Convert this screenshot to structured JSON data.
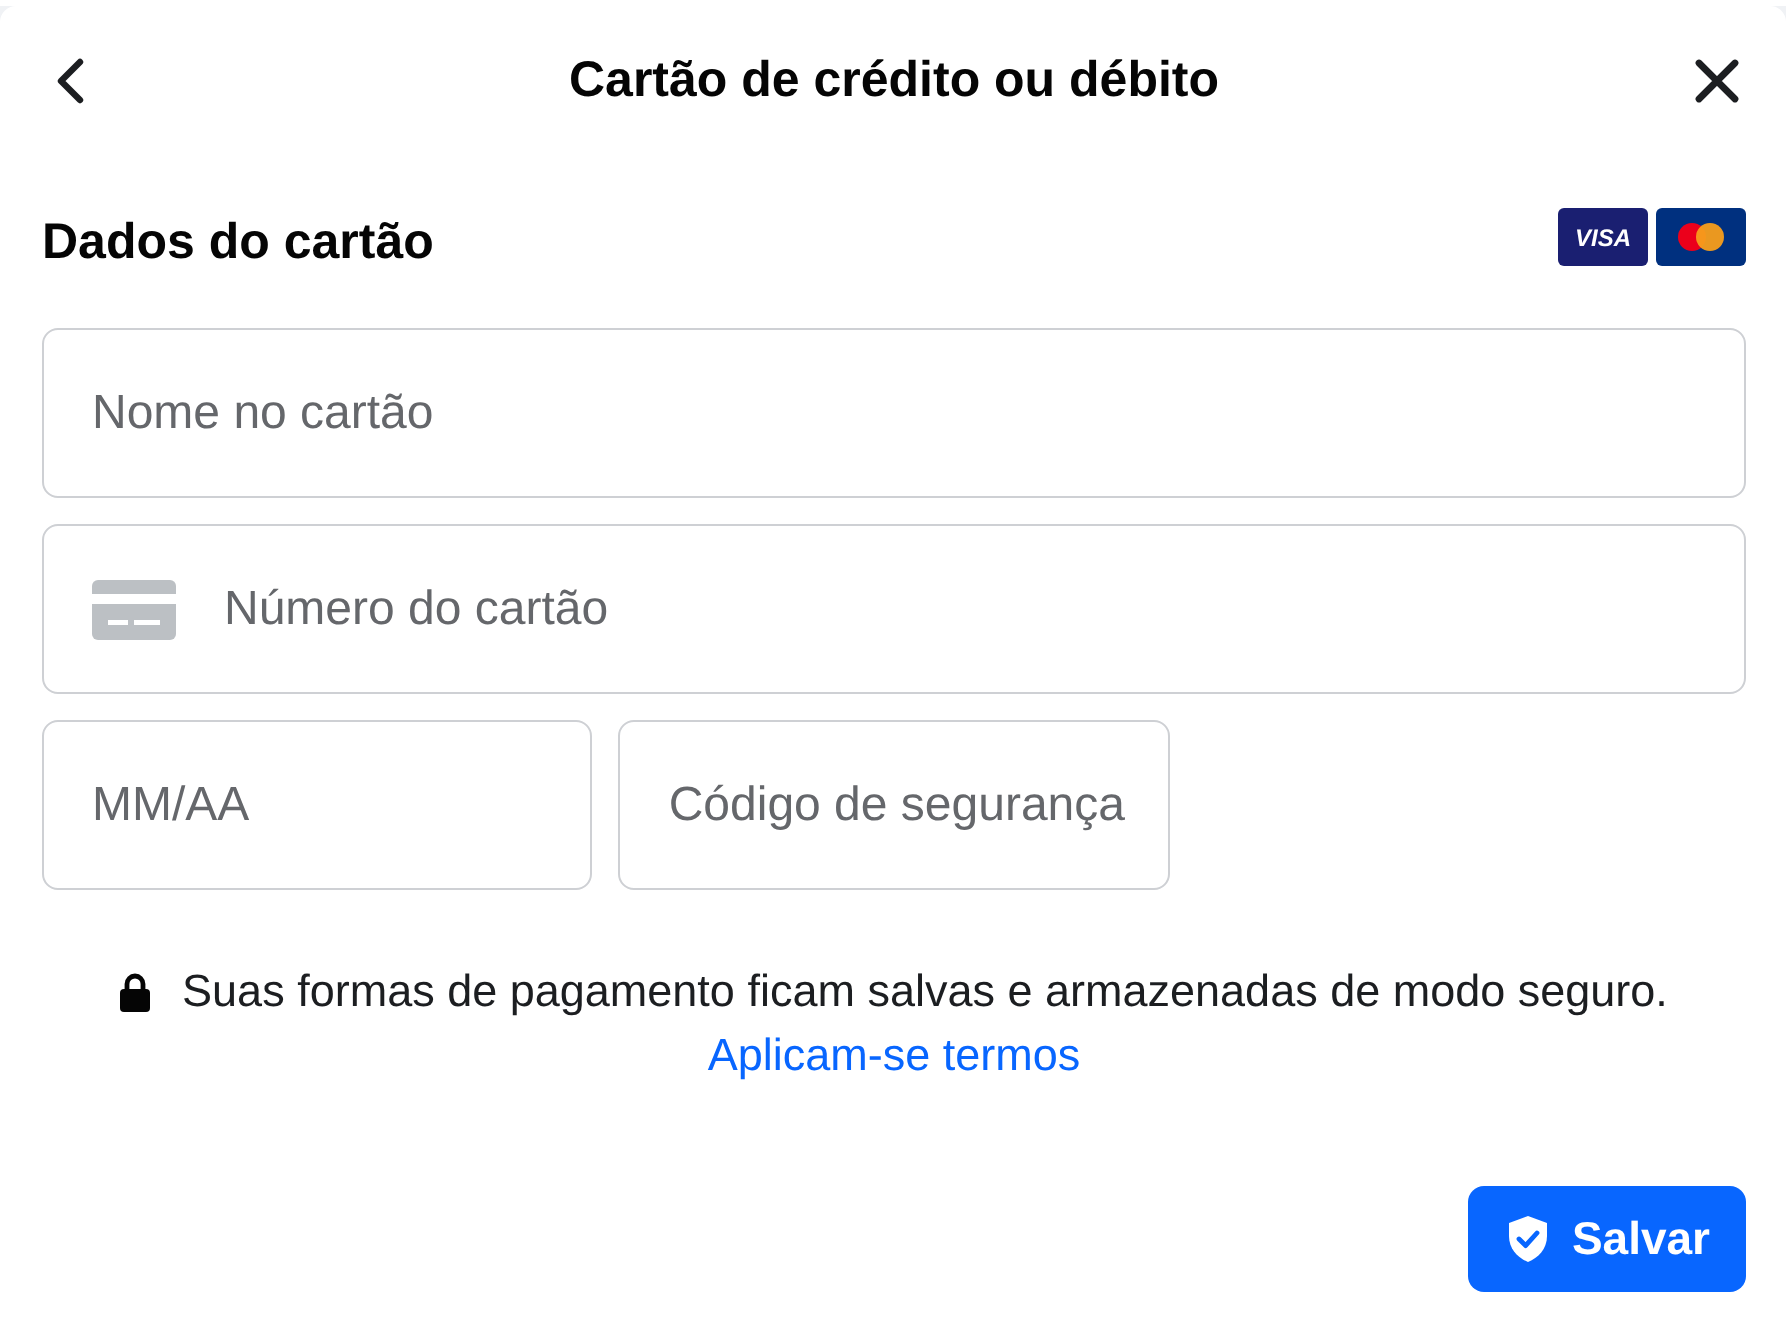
{
  "header": {
    "title": "Cartão de crédito ou débito"
  },
  "section": {
    "title": "Dados do cartão",
    "card_brands": [
      {
        "kind": "visa",
        "label": "VISA"
      },
      {
        "kind": "mastercard"
      }
    ]
  },
  "form_rows": [
    {
      "fields": [
        {
          "kind": "name",
          "placeholder": "Nome no cartão"
        }
      ]
    },
    {
      "fields": [
        {
          "kind": "card_number",
          "placeholder": "Número do cartão"
        }
      ]
    },
    {
      "fields": [
        {
          "kind": "expiry",
          "placeholder": "MM/AA"
        },
        {
          "kind": "security_code",
          "placeholder": "Código de segurança"
        }
      ]
    }
  ],
  "notice": {
    "text": "Suas formas de pagamento ficam salvas e armazenadas de modo seguro.",
    "link": "Aplicam-se termos"
  },
  "save_button": {
    "label": "Salvar"
  }
}
